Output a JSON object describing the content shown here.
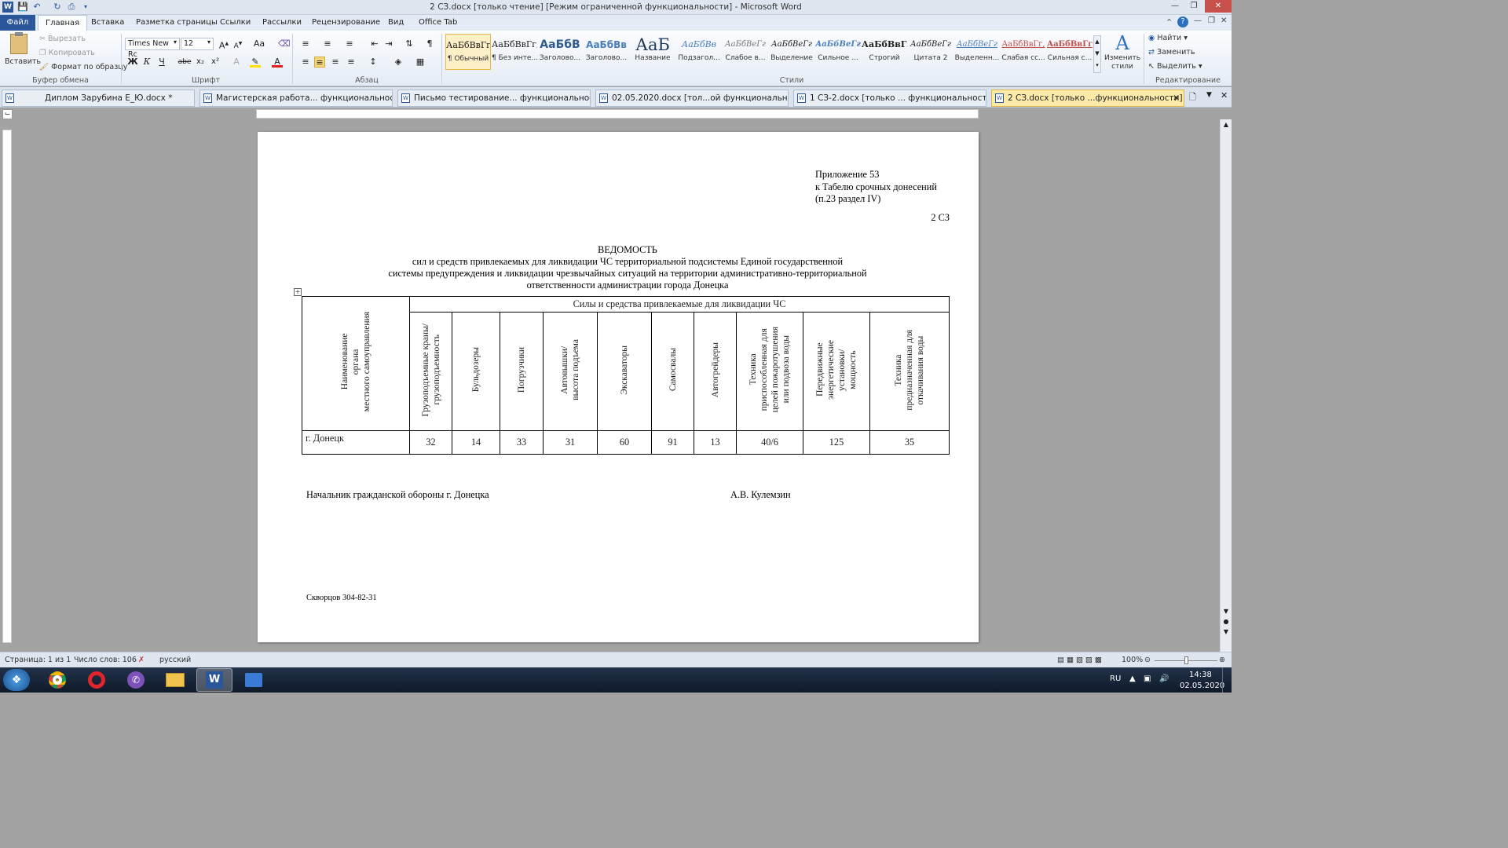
{
  "window": {
    "title": "2 СЗ.docx [только чтение] [Режим ограниченной функциональности]  -  Microsoft Word",
    "app_icon": "W",
    "quick_access": [
      "save-icon",
      "undo-icon",
      "redo-icon",
      "print-icon",
      "chevron-down-icon"
    ],
    "controls": [
      "minimize-icon",
      "restore-icon",
      "close-icon"
    ]
  },
  "ribbon_tabs": [
    "Файл",
    "Главная",
    "Вставка",
    "Разметка страницы",
    "Ссылки",
    "Рассылки",
    "Рецензирование",
    "Вид",
    "Office Tab"
  ],
  "clipboard": {
    "paste": "Вставить",
    "cut": "Вырезать",
    "copy": "Копировать",
    "format_painter": "Формат по образцу",
    "group": "Буфер обмена"
  },
  "font": {
    "name": "Times New Rc",
    "size": "12",
    "group": "Шрифт",
    "case_btn": "Aa",
    "bold": "Ж",
    "italic": "К",
    "underline": "Ч",
    "strike": "abe",
    "sub": "x₂",
    "sup": "x²"
  },
  "paragraph": {
    "group": "Абзац"
  },
  "styles": {
    "group": "Стили",
    "items": [
      {
        "sample": "АаБбВвГг,",
        "name": "¶ Обычный"
      },
      {
        "sample": "АаБбВвГг,",
        "name": "¶ Без инте..."
      },
      {
        "sample": "АаБбВ",
        "name": "Заголово..."
      },
      {
        "sample": "АаБбВв",
        "name": "Заголово..."
      },
      {
        "sample": "АаБ",
        "name": "Название"
      },
      {
        "sample": "АаБбВв",
        "name": "Подзагол..."
      },
      {
        "sample": "АаБбВеГг",
        "name": "Слабое в..."
      },
      {
        "sample": "АаБбВеГг",
        "name": "Выделение"
      },
      {
        "sample": "АаБбВеГг",
        "name": "Сильное ..."
      },
      {
        "sample": "АаБбВвГг,",
        "name": "Строгий"
      },
      {
        "sample": "АаБбВеГг",
        "name": "Цитата 2"
      },
      {
        "sample": "АаБбВеГг",
        "name": "Выделенн..."
      },
      {
        "sample": "АаБбВвГг,",
        "name": "Слабая сс..."
      },
      {
        "sample": "АаБбВвГг,",
        "name": "Сильная с..."
      }
    ],
    "change": "Изменить стили"
  },
  "editing": {
    "find": "Найти",
    "replace": "Заменить",
    "select": "Выделить",
    "group": "Редактирование"
  },
  "doc_tabs": [
    "Диплом Зарубина Е_Ю.docx *",
    "Магистерская работа... функциональности]",
    "Письмо тестирование... функциональности]",
    "02.05.2020.docx [тол...ой функциональности]",
    "1 СЗ-2.docx [только ... функциональности] *",
    "2 СЗ.docx [только ...функциональности]"
  ],
  "document": {
    "appendix": [
      "Приложение 53",
      "к Табелю срочных донесений",
      "(п.23 раздел IV)"
    ],
    "code": "2 СЗ",
    "title": "ВЕДОМОСТЬ",
    "subtitle": [
      "сил и средств привлекаемых для ликвидации ЧС территориальной подсистемы Единой государственной",
      "системы предупреждения и ликвидации чрезвычайных ситуаций на территории административно-территориальной",
      "ответственности администрации города Донецка"
    ],
    "table": {
      "row_header": "Наименование\nоргана\nместного самоуправления",
      "group_header": "Силы и средства привлекаемые для ликвидации ЧС",
      "columns": [
        "Грузоподъемные краны/\nгрузоподъемность",
        "Бульдозеры",
        "Погрузчики",
        "Автовышки/\nвысота подъема",
        "Экскаваторы",
        "Самосвалы",
        "Автогрейдеры",
        "Техника\nприспособленная для\nцелей пожаротушения\nили подвоза воды",
        "Передвижные\nэнергетические\nустановки/\nмощность",
        "Техника\nпредназначенная для\nоткачивания воды"
      ],
      "rows": [
        {
          "name": "г. Донецк",
          "values": [
            "32",
            "14",
            "33",
            "31",
            "60",
            "91",
            "13",
            "40/6",
            "125",
            "35"
          ]
        }
      ]
    },
    "signature_role": "Начальник гражданской обороны г. Донецка",
    "signature_name": "А.В. Кулемзин",
    "footer": "Скворцов  304-82-31"
  },
  "status": {
    "page": "Страница: 1 из 1",
    "words": "Число слов: 106",
    "lang": "русский",
    "zoom": "100%"
  },
  "taskbar": {
    "lang": "RU",
    "time": "14:38",
    "date": "02.05.2020"
  }
}
